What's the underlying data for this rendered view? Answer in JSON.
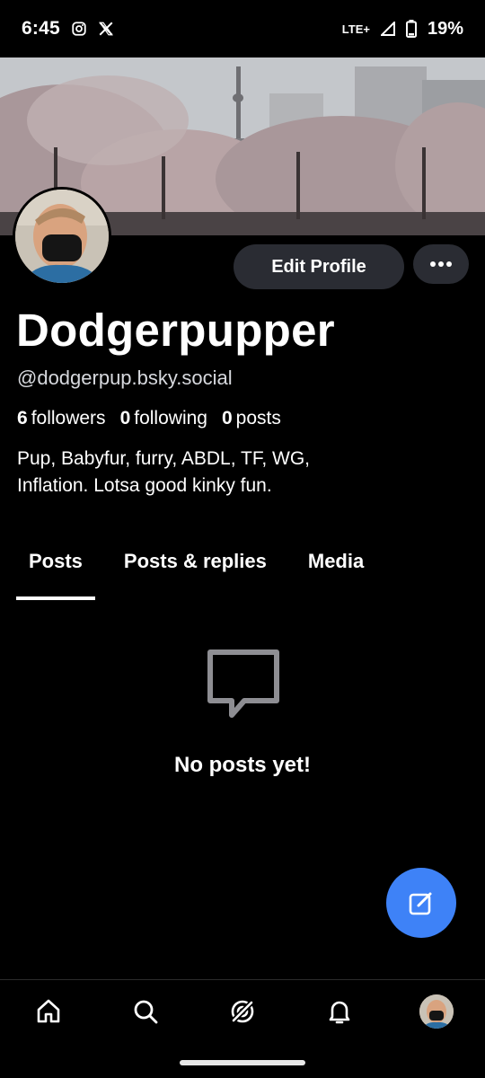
{
  "status_bar": {
    "time": "6:45",
    "network": "LTE+",
    "battery": "19%",
    "icons": [
      "instagram-icon",
      "x-icon",
      "signal-icon",
      "battery-icon"
    ]
  },
  "profile": {
    "display_name": "Dodgerpupper",
    "handle": "@dodgerpup.bsky.social",
    "followers_count": "6",
    "followers_label": "followers",
    "following_count": "0",
    "following_label": "following",
    "posts_count": "0",
    "posts_label": "posts",
    "bio_line1": "Pup, Babyfur, furry, ABDL, TF, WG,",
    "bio_line2": "Inflation. Lotsa good kinky fun.",
    "edit_label": "Edit Profile"
  },
  "tabs": [
    {
      "label": "Posts",
      "active": true
    },
    {
      "label": "Posts & replies",
      "active": false
    },
    {
      "label": "Media",
      "active": false
    }
  ],
  "empty_state": {
    "message": "No posts yet!"
  },
  "bottom_nav": [
    "home-icon",
    "search-icon",
    "feeds-icon",
    "notifications-icon",
    "profile-avatar"
  ],
  "colors": {
    "accent": "#3e82f7",
    "button_bg": "#2a2c33",
    "background": "#000000"
  }
}
